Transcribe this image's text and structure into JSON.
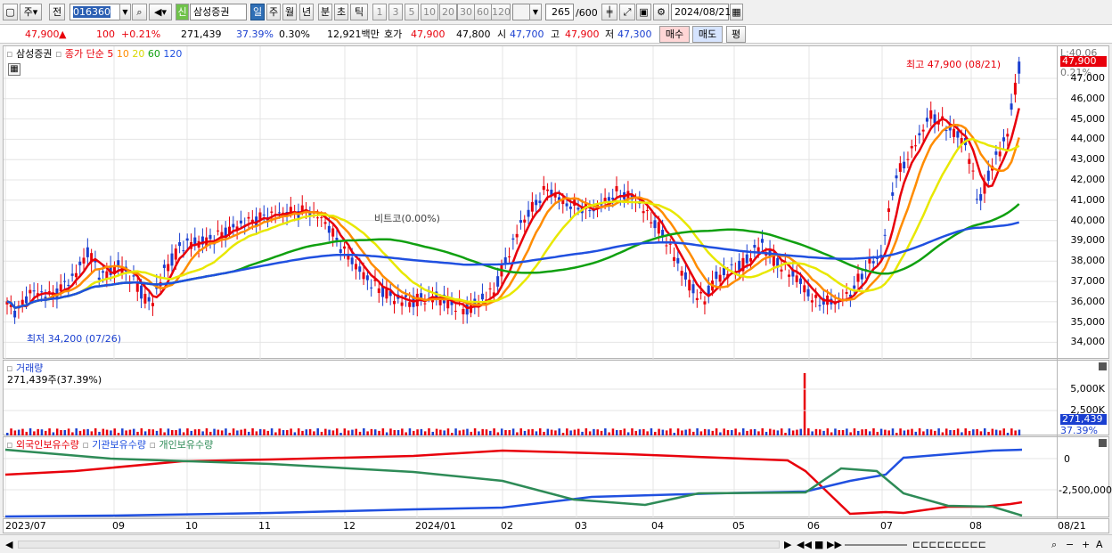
{
  "toolbar": {
    "market": "주",
    "prev": "전",
    "code": "016360",
    "credit": "신",
    "name": "삼성증권",
    "periods": [
      "일",
      "주",
      "월",
      "년",
      "분",
      "초",
      "틱"
    ],
    "active_period": "일",
    "intervals": [
      "1",
      "3",
      "5",
      "10",
      "20",
      "30",
      "60",
      "120"
    ],
    "count": "265",
    "count_total": "/600",
    "date": "2024/08/21"
  },
  "quote": {
    "price": "47,900",
    "arrow": "▲",
    "change": "100",
    "change_pct": "+0.21%",
    "volume": "271,439",
    "vol_ratio": "37.39%",
    "turnover": "0.30%",
    "amount": "12,921백만",
    "ask_label": "호가",
    "ask": "47,900",
    "bid": "47,800",
    "open_label": "시",
    "open": "47,700",
    "high_label": "고",
    "high": "47,900",
    "low_label": "저",
    "low": "47,300",
    "buy": "매수",
    "sell": "매도",
    "eval": "평"
  },
  "price_panel": {
    "name": "삼성증권",
    "ma_label": "종가 단순",
    "ma_periods": [
      "5",
      "10",
      "20",
      "60",
      "120"
    ],
    "ma_colors": [
      "#e8000b",
      "#ff8c00",
      "#e8e800",
      "#10a010",
      "#2050e0"
    ],
    "price_tag": "47,900",
    "pct_tag": "0.21%",
    "top_tag": "L:40.06",
    "high_note": "최고 47,900 (08/21)",
    "low_note": "최저 34,200 (07/26)",
    "mid_note": "비트코(0.00%)",
    "yticks": [
      "47,000",
      "46,000",
      "45,000",
      "44,000",
      "43,000",
      "42,000",
      "41,000",
      "40,000",
      "39,000",
      "38,000",
      "37,000",
      "36,000",
      "35,000",
      "34,000"
    ]
  },
  "volume_panel": {
    "title": "거래량",
    "value": "271,439주(37.39%)",
    "yticks": [
      "5,000K",
      "2,500K"
    ],
    "tag1": "271,439",
    "tag2": "37.39%"
  },
  "holding_panel": {
    "series": [
      "외국인보유수량",
      "기관보유수량",
      "개인보유수량"
    ],
    "colors": [
      "#e8000b",
      "#2050e0",
      "#2e8b57"
    ],
    "yticks": [
      "0",
      "-2,500,000"
    ]
  },
  "date_axis": [
    "2023/07",
    "09",
    "10",
    "11",
    "12",
    "2024/01",
    "02",
    "03",
    "04",
    "05",
    "06",
    "07",
    "08",
    "08/21"
  ]
}
